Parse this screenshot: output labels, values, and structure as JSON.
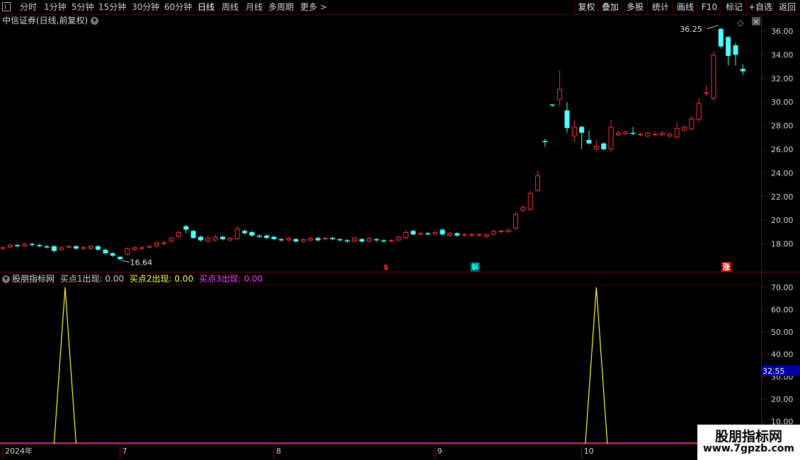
{
  "toolbar": {
    "periods": [
      "分时",
      "1分钟",
      "5分钟",
      "15分钟",
      "30分钟",
      "60分钟",
      "日线",
      "周线",
      "月线",
      "多周期",
      "更多 >"
    ],
    "active_period": "日线",
    "right_buttons": [
      "复权",
      "叠加",
      "多股",
      "统计",
      "画线",
      "F10",
      "标记",
      "+自选",
      "返回"
    ]
  },
  "main_panel": {
    "title": "中信证券(日线,前复权)",
    "dropdown_icon": "chevron-down-icon",
    "settings_icon": "diamond-icon",
    "close_icon": "close-icon",
    "high_label": "36.25",
    "low_label": "16.64",
    "markers": [
      {
        "text": "$",
        "color": "#ff3030",
        "bg": "#000000"
      },
      {
        "text": "解",
        "color": "#00ffff",
        "bg": "#003a3a"
      },
      {
        "text": "涨",
        "color": "#ffffff",
        "bg": "#c00000"
      }
    ]
  },
  "indicator_panel": {
    "name": "股朋指标网",
    "fields": [
      {
        "label": "买点1出现:",
        "value": "0.00",
        "color": "#d0d0d0"
      },
      {
        "label": "买点2出现:",
        "value": "0.00",
        "color": "#ffff50"
      },
      {
        "label": "买点3出现:",
        "value": "0.00",
        "color": "#ff40ff"
      }
    ],
    "current_value_label": "32.55"
  },
  "chart_data": [
    {
      "type": "candlestick",
      "ylim": [
        16.0,
        37.0
      ],
      "yticks": [
        "18.00",
        "20.00",
        "22.00",
        "24.00",
        "26.00",
        "28.00",
        "30.00",
        "32.00",
        "34.00",
        "36.00"
      ],
      "colors": {
        "up": "#ff3232",
        "down": "#54ffff"
      },
      "candles": [
        [
          17.6,
          17.7,
          17.5,
          17.8
        ],
        [
          17.7,
          17.9,
          17.6,
          18.0
        ],
        [
          17.9,
          17.8,
          17.7,
          18.0
        ],
        [
          17.8,
          18.0,
          17.7,
          18.1
        ],
        [
          18.0,
          17.9,
          17.8,
          18.1
        ],
        [
          17.9,
          17.8,
          17.7,
          18.0
        ],
        [
          17.8,
          17.7,
          17.6,
          17.9
        ],
        [
          17.8,
          17.4,
          17.3,
          17.9
        ],
        [
          17.5,
          17.7,
          17.4,
          17.8
        ],
        [
          17.7,
          17.8,
          17.6,
          17.9
        ],
        [
          17.8,
          17.6,
          17.5,
          17.9
        ],
        [
          17.6,
          17.7,
          17.5,
          17.8
        ],
        [
          17.6,
          17.8,
          17.5,
          17.9
        ],
        [
          17.8,
          17.5,
          17.4,
          17.9
        ],
        [
          17.5,
          17.2,
          17.1,
          17.6
        ],
        [
          17.2,
          17.0,
          16.9,
          17.3
        ],
        [
          16.9,
          16.7,
          16.64,
          17.0
        ],
        [
          17.1,
          17.6,
          17.0,
          17.7
        ],
        [
          17.5,
          17.7,
          17.4,
          17.8
        ],
        [
          17.6,
          17.7,
          17.5,
          17.8
        ],
        [
          17.7,
          17.8,
          17.6,
          17.9
        ],
        [
          17.8,
          18.1,
          17.7,
          18.2
        ],
        [
          18.0,
          18.1,
          17.9,
          18.3
        ],
        [
          18.2,
          18.5,
          18.1,
          18.6
        ],
        [
          18.6,
          19.0,
          18.5,
          19.1
        ],
        [
          19.5,
          19.2,
          18.9,
          19.6
        ],
        [
          19.1,
          18.5,
          18.4,
          19.2
        ],
        [
          18.6,
          18.3,
          18.2,
          18.7
        ],
        [
          18.2,
          18.5,
          18.1,
          18.7
        ],
        [
          18.3,
          18.6,
          18.2,
          18.8
        ],
        [
          18.6,
          18.4,
          18.3,
          18.7
        ],
        [
          18.3,
          18.5,
          18.2,
          18.6
        ],
        [
          18.4,
          19.3,
          18.3,
          19.5
        ],
        [
          19.1,
          18.9,
          18.8,
          19.2
        ],
        [
          19.0,
          18.7,
          18.6,
          19.1
        ],
        [
          18.7,
          18.6,
          18.5,
          18.8
        ],
        [
          18.7,
          18.5,
          18.4,
          18.8
        ],
        [
          18.6,
          18.4,
          18.3,
          18.7
        ],
        [
          18.4,
          18.3,
          18.2,
          18.5
        ],
        [
          18.3,
          18.5,
          18.2,
          18.6
        ],
        [
          18.4,
          18.2,
          18.1,
          18.5
        ],
        [
          18.2,
          18.4,
          18.1,
          18.5
        ],
        [
          18.3,
          18.5,
          18.2,
          18.6
        ],
        [
          18.5,
          18.3,
          18.2,
          18.6
        ],
        [
          18.4,
          18.5,
          18.3,
          18.6
        ],
        [
          18.5,
          18.4,
          18.3,
          18.6
        ],
        [
          18.4,
          18.3,
          18.2,
          18.5
        ],
        [
          18.3,
          18.2,
          18.1,
          18.4
        ],
        [
          18.2,
          18.5,
          18.1,
          18.6
        ],
        [
          18.4,
          18.2,
          18.1,
          18.5
        ],
        [
          18.2,
          18.5,
          18.1,
          18.6
        ],
        [
          18.4,
          18.3,
          18.2,
          18.5
        ],
        [
          18.3,
          18.2,
          18.1,
          18.4
        ],
        [
          18.2,
          18.3,
          18.1,
          18.4
        ],
        [
          18.3,
          18.6,
          18.2,
          18.7
        ],
        [
          18.5,
          19.0,
          18.4,
          19.2
        ],
        [
          19.1,
          18.8,
          18.7,
          19.2
        ],
        [
          18.8,
          18.9,
          18.7,
          19.0
        ],
        [
          18.9,
          18.8,
          18.7,
          19.0
        ],
        [
          18.8,
          19.0,
          18.7,
          19.1
        ],
        [
          19.2,
          18.8,
          18.7,
          19.3
        ],
        [
          18.7,
          18.9,
          18.6,
          19.0
        ],
        [
          18.9,
          18.7,
          18.6,
          19.0
        ],
        [
          18.7,
          18.8,
          18.6,
          18.9
        ],
        [
          18.7,
          18.8,
          18.6,
          18.9
        ],
        [
          18.7,
          18.8,
          18.6,
          18.9
        ],
        [
          18.6,
          18.8,
          18.5,
          18.9
        ],
        [
          18.8,
          19.1,
          18.7,
          19.2
        ],
        [
          19.0,
          19.1,
          18.9,
          19.2
        ],
        [
          19.0,
          19.2,
          18.9,
          19.3
        ],
        [
          19.3,
          20.5,
          19.2,
          20.7
        ],
        [
          20.8,
          21.1,
          20.7,
          21.3
        ],
        [
          20.9,
          22.3,
          20.8,
          22.5
        ],
        [
          22.5,
          23.8,
          22.4,
          24.2
        ],
        [
          26.7,
          26.6,
          26.2,
          26.9
        ],
        [
          29.8,
          29.7,
          29.6,
          29.8
        ],
        [
          30.2,
          31.1,
          29.6,
          32.7
        ],
        [
          29.3,
          27.8,
          27.4,
          30.0
        ],
        [
          27.1,
          27.9,
          26.6,
          28.5
        ],
        [
          27.9,
          27.4,
          26.0,
          28.0
        ],
        [
          26.8,
          26.5,
          26.4,
          27.6
        ],
        [
          26.0,
          26.3,
          25.9,
          26.8
        ],
        [
          26.5,
          26.0,
          25.9,
          26.6
        ],
        [
          26.0,
          27.9,
          25.8,
          28.5
        ],
        [
          27.2,
          27.4,
          27.1,
          27.6
        ],
        [
          27.3,
          27.5,
          27.2,
          27.6
        ],
        [
          27.4,
          27.3,
          27.2,
          27.9
        ],
        [
          27.2,
          27.3,
          27.1,
          27.4
        ],
        [
          27.1,
          27.4,
          27.0,
          27.5
        ],
        [
          27.2,
          27.3,
          27.1,
          27.5
        ],
        [
          27.2,
          27.4,
          27.1,
          27.5
        ],
        [
          27.1,
          27.3,
          27.0,
          27.5
        ],
        [
          27.0,
          27.8,
          26.9,
          28.3
        ],
        [
          27.6,
          27.9,
          27.5,
          28.0
        ],
        [
          27.7,
          28.6,
          27.6,
          28.8
        ],
        [
          28.5,
          29.9,
          28.3,
          30.3
        ],
        [
          30.8,
          30.8,
          30.5,
          31.4
        ],
        [
          30.3,
          34.0,
          30.1,
          34.3
        ],
        [
          36.2,
          34.7,
          34.5,
          36.25
        ],
        [
          35.5,
          33.9,
          33.1,
          35.6
        ],
        [
          34.8,
          34.0,
          33.1,
          35.0
        ],
        [
          32.8,
          32.6,
          32.3,
          33.2
        ]
      ]
    },
    {
      "type": "line",
      "ylim": [
        0,
        75
      ],
      "yticks": [
        "10.00",
        "20.00",
        "30.00",
        "40.00",
        "50.00",
        "60.00",
        "70.00"
      ],
      "x_labels": [
        "2024年",
        "7",
        "8",
        "9",
        "10"
      ],
      "x_label_bars": [
        0,
        16,
        37,
        59,
        79
      ],
      "series": [
        {
          "name": "",
          "color": "#ffff40",
          "points": [
            [
              7,
              0
            ],
            [
              8.5,
              70
            ],
            [
              10,
              0
            ],
            [
              79.5,
              0
            ],
            [
              81,
              70
            ],
            [
              82.5,
              0
            ]
          ]
        }
      ],
      "baseline_color": "#c040c0"
    }
  ]
}
